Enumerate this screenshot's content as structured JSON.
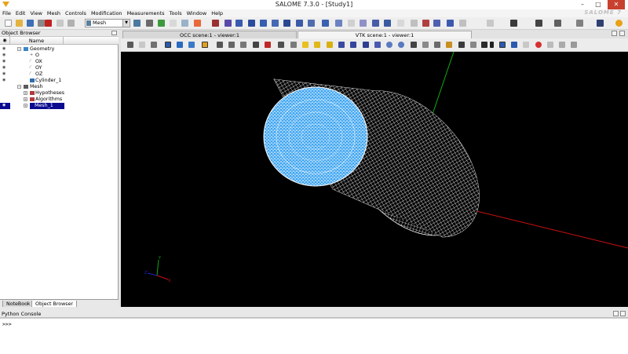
{
  "window": {
    "title": "SALOME 7.3.0 - [Study1]",
    "minimize": "–",
    "maximize": "□",
    "close": "✕"
  },
  "brand": "SALOME 7",
  "menubar": [
    "File",
    "Edit",
    "View",
    "Mesh",
    "Controls",
    "Modification",
    "Measurements",
    "Tools",
    "Window",
    "Help"
  ],
  "toolbar": {
    "module_combo": "Mesh"
  },
  "object_browser": {
    "title": "Object Browser",
    "col_eye": "◉",
    "col_name": "Name",
    "rows": [
      {
        "label": "Geometry",
        "level": 1,
        "expander": "−",
        "eye": "◉"
      },
      {
        "label": "O",
        "level": 2,
        "eye": "◉"
      },
      {
        "label": "OX",
        "level": 2,
        "eye": "◉"
      },
      {
        "label": "OY",
        "level": 2,
        "eye": "◉"
      },
      {
        "label": "OZ",
        "level": 2,
        "eye": "◉"
      },
      {
        "label": "Cylinder_1",
        "level": 2,
        "eye": "◉"
      },
      {
        "label": "Mesh",
        "level": 1,
        "expander": "−",
        "eye": ""
      },
      {
        "label": "Hypotheses",
        "level": 2,
        "expander": "+",
        "eye": ""
      },
      {
        "label": "Algorithms",
        "level": 2,
        "expander": "+",
        "eye": ""
      },
      {
        "label": "Mesh_1",
        "level": 2,
        "expander": "+",
        "eye": "◉",
        "selected": true
      }
    ],
    "tabs": [
      "NoteBook",
      "Object Browser"
    ]
  },
  "viewer": {
    "tabs": [
      "OCC scene:1 - viewer:1",
      "VTK scene:1 - viewer:1"
    ],
    "active_tab": 1,
    "axes": {
      "x": "X",
      "y": "Y",
      "z": "Z"
    }
  },
  "console": {
    "title": "Python Console",
    "prompt": ">>>"
  },
  "colors": {
    "mesh_face": "#3aa3f2",
    "mesh_lines": "#ffffff",
    "selection": "#0a0a90",
    "axis_x": "#cc1111",
    "axis_y": "#11aa11",
    "axis_z": "#2222cc"
  }
}
